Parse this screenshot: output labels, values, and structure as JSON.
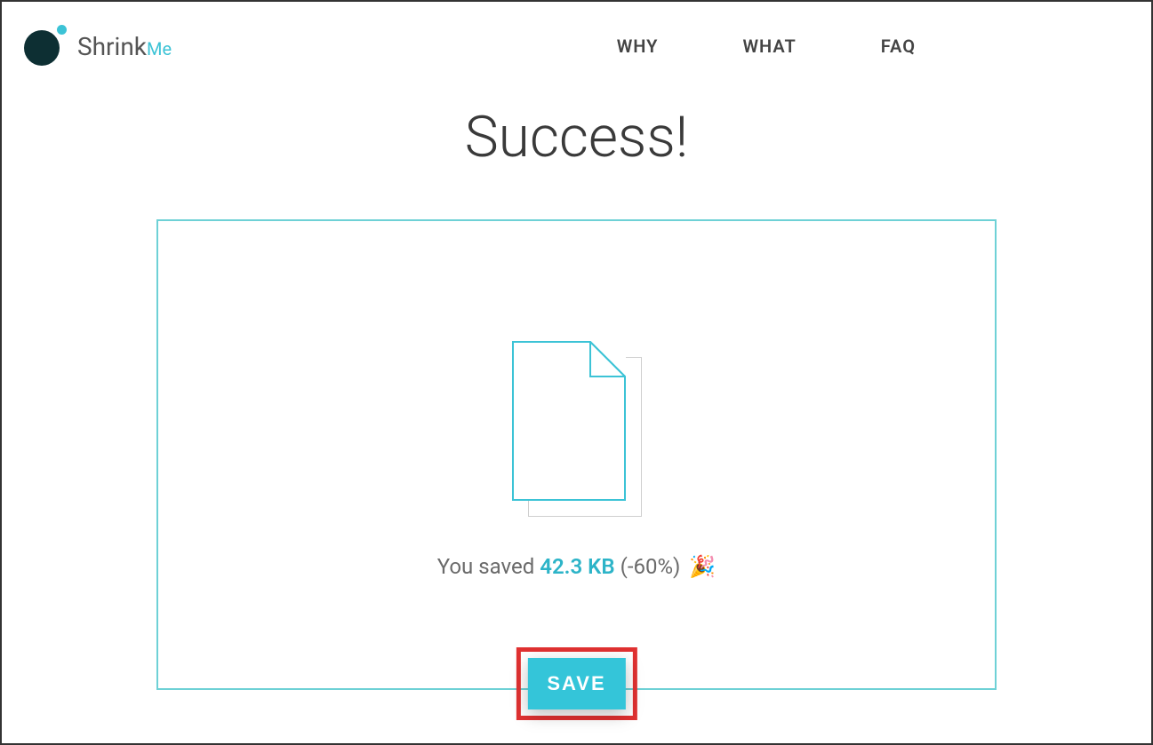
{
  "header": {
    "logo_main": "Shrink",
    "logo_accent": "Me",
    "nav": [
      {
        "label": "WHY"
      },
      {
        "label": "WHAT"
      },
      {
        "label": "FAQ"
      }
    ]
  },
  "main": {
    "title": "Success!",
    "saved_prefix": "You saved",
    "saved_amount": "42.3 KB",
    "saved_percent": "(-60%)",
    "party_emoji": "🎉",
    "save_button": "SAVE"
  },
  "colors": {
    "accent": "#3cc3d6",
    "highlight_border": "#e03131"
  }
}
